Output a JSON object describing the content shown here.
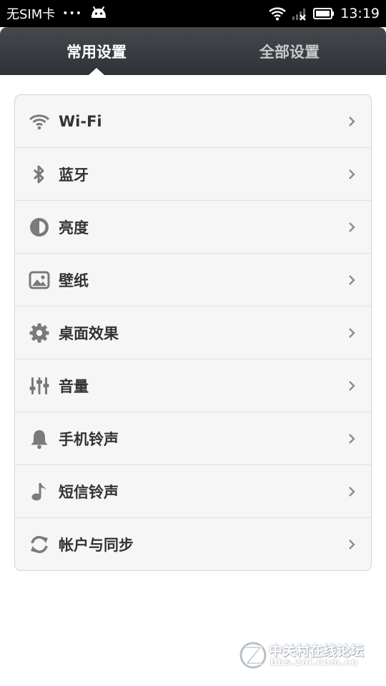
{
  "status_bar": {
    "carrier": "无SIM卡",
    "dots": "•••",
    "time": "13:19",
    "icons": [
      "android-icon",
      "wifi-icon",
      "signal-off-icon",
      "battery-icon"
    ]
  },
  "tabs": [
    {
      "label": "常用设置",
      "selected": true
    },
    {
      "label": "全部设置",
      "selected": false
    }
  ],
  "settings": [
    {
      "label": "Wi-Fi",
      "icon": "wifi-icon"
    },
    {
      "label": "蓝牙",
      "icon": "bluetooth-icon"
    },
    {
      "label": "亮度",
      "icon": "brightness-icon"
    },
    {
      "label": "壁纸",
      "icon": "wallpaper-icon"
    },
    {
      "label": "桌面效果",
      "icon": "gear-icon"
    },
    {
      "label": "音量",
      "icon": "volume-sliders-icon"
    },
    {
      "label": "手机铃声",
      "icon": "bell-icon"
    },
    {
      "label": "短信铃声",
      "icon": "music-note-icon"
    },
    {
      "label": "帐户与同步",
      "icon": "sync-icon"
    }
  ],
  "watermark": {
    "title": "中关村在线论坛",
    "url": "bbs.zol.com.cn"
  },
  "colors": {
    "tab_bar": "#3a3d41",
    "icon_gray": "#7a7a7a",
    "text": "#333333"
  }
}
